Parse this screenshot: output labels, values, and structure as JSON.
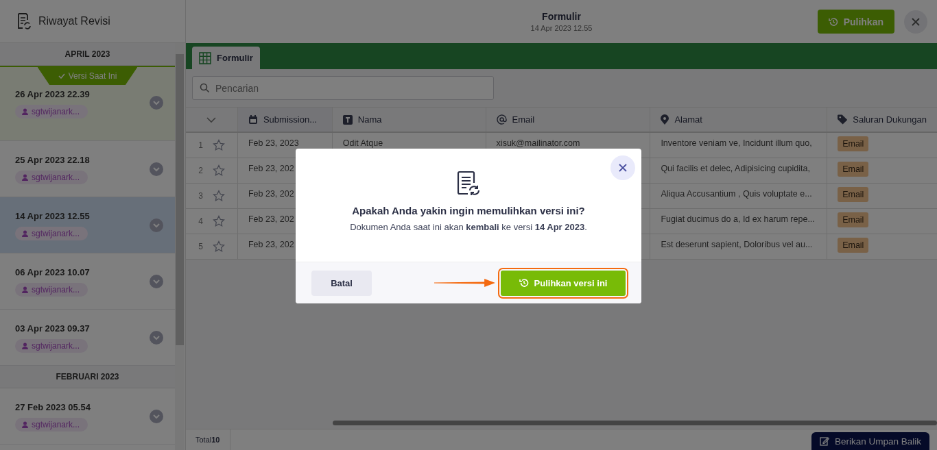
{
  "sidebar": {
    "title": "Riwayat Revisi",
    "groups": [
      {
        "month": "APRIL 2023",
        "items": [
          {
            "date": "26 Apr 2023 22.39",
            "user": "sgtwijanark...",
            "current": true,
            "current_label": "Versi Saat Ini",
            "selected": false
          },
          {
            "date": "25 Apr 2023 22.18",
            "user": "sgtwijanark...",
            "current": false,
            "selected": false
          },
          {
            "date": "14 Apr 2023 12.55",
            "user": "sgtwijanark...",
            "current": false,
            "selected": true
          },
          {
            "date": "06 Apr 2023 10.07",
            "user": "sgtwijanark...",
            "current": false,
            "selected": false
          },
          {
            "date": "03 Apr 2023 09.37",
            "user": "sgtwijanark...",
            "current": false,
            "selected": false
          }
        ]
      },
      {
        "month": "FEBRUARI 2023",
        "items": [
          {
            "date": "27 Feb 2023 05.54",
            "user": "sgtwijanark...",
            "current": false,
            "selected": false
          }
        ]
      }
    ]
  },
  "header": {
    "title": "Formulir",
    "subtitle": "14 Apr 2023 12.55",
    "restore_button": "Pulihkan"
  },
  "tabs": [
    {
      "label": "Formulir",
      "selected": true
    }
  ],
  "search": {
    "placeholder": "Pencarian"
  },
  "table": {
    "columns": [
      {
        "label": "Submission...",
        "kind": "date"
      },
      {
        "label": "Nama",
        "kind": "text"
      },
      {
        "label": "Email",
        "kind": "email"
      },
      {
        "label": "Alamat",
        "kind": "location"
      },
      {
        "label": "Saluran Dukungan",
        "kind": "tag"
      }
    ],
    "rows": [
      {
        "number": "1",
        "starred": false,
        "cells": [
          "Feb 23, 2023",
          "Odit Atque",
          "xisuk@mailinator.com",
          "Inventore veniam ve, Incidunt illum quo,",
          "Email"
        ]
      },
      {
        "number": "2",
        "starred": false,
        "cells": [
          "Feb 23, 202",
          "",
          "",
          "Qui facilis et delec, Adipisicing cupidita,",
          "Email"
        ]
      },
      {
        "number": "3",
        "starred": false,
        "cells": [
          "Feb 23, 202",
          "",
          "",
          "Aliqua Accusantium , Quis voluptate e...",
          "Email"
        ]
      },
      {
        "number": "4",
        "starred": false,
        "cells": [
          "Feb 23, 202",
          "",
          "",
          "Fugiat ducimus do a, Id ex harum repe...",
          "Email"
        ]
      },
      {
        "number": "5",
        "starred": false,
        "cells": [
          "Feb 23, 202",
          "",
          "",
          "Est deserunt sapient, Doloribus vel au...",
          "Email"
        ]
      }
    ]
  },
  "footer": {
    "total_label": "Total",
    "total": "10",
    "feedback_button": "Berikan Umpan Balik"
  },
  "dialog": {
    "title": "Apakah Anda yakin ingin memulihkan versi ini?",
    "message": "Dokumen Anda saat ini akan **kembali** ke versi **14 Apr 2023**.",
    "cancel_button": "Batal",
    "confirm_button": "Pulihkan versi ini"
  }
}
